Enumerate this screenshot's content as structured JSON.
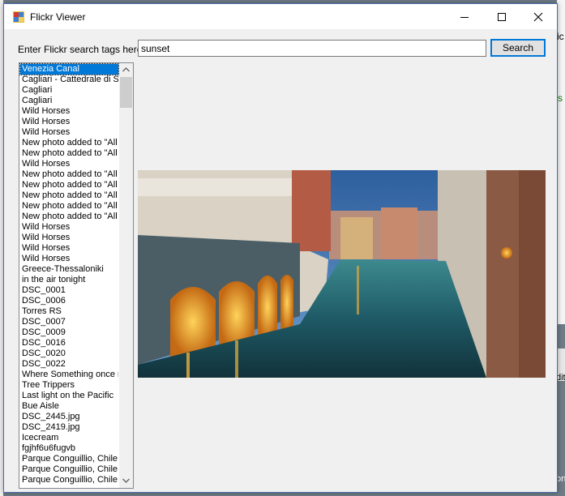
{
  "window": {
    "title": "Flickr Viewer"
  },
  "background": {
    "fragment_top": "ic",
    "fragment_green": "s",
    "fragment_right": "dit",
    "fragment_bottom": "on"
  },
  "search": {
    "label": "Enter Flickr search tags here:",
    "value": "sunset",
    "button_label": "Search"
  },
  "results": {
    "selected_index": 0,
    "items": [
      "Venezia Canal",
      "Cagliari - Cattedrale di Santa Maria",
      "Cagliari",
      "Cagliari",
      "Wild Horses",
      "Wild Horses",
      "Wild Horses",
      "New photo added to \"All",
      "New photo added to \"All",
      "Wild Horses",
      "New photo added to \"All",
      "New photo added to \"All",
      "New photo added to \"All",
      "New photo added to \"All",
      "New photo added to \"All",
      "Wild Horses",
      "Wild Horses",
      "Wild Horses",
      "Wild Horses",
      "Greece-Thessaloniki",
      "in the air tonight",
      "DSC_0001",
      "DSC_0006",
      "Torres RS",
      "DSC_0007",
      "DSC_0009",
      "DSC_0016",
      "DSC_0020",
      "DSC_0022",
      "Where Something once ran",
      "Tree Trippers",
      "Last light on the Pacific",
      "Bue Aisle",
      "DSC_2445.jpg",
      "DSC_2419.jpg",
      "Icecream",
      "fgjhf6u6fugvb",
      "Parque Conguillio, Chile.",
      "Parque Conguillio, Chile.",
      "Parque Conguillio, Chile."
    ]
  },
  "colors": {
    "accent": "#0078d7",
    "window_bg": "#f0f0f0"
  }
}
